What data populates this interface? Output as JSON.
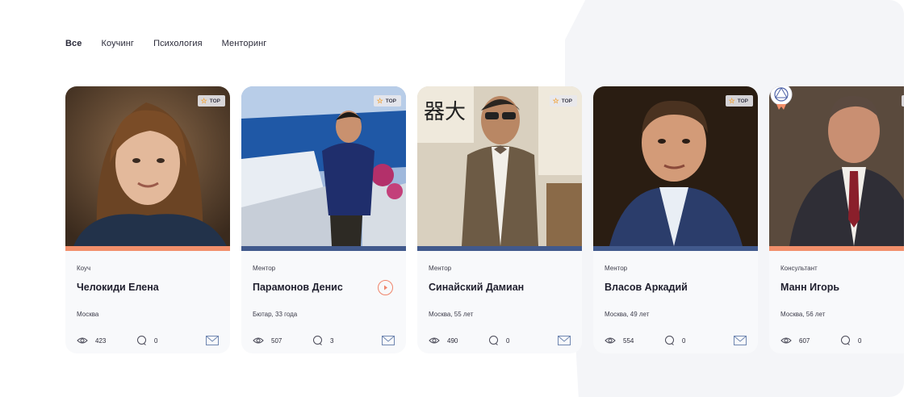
{
  "tabs": [
    {
      "label": "Все",
      "active": true
    },
    {
      "label": "Коучинг",
      "active": false
    },
    {
      "label": "Психология",
      "active": false
    },
    {
      "label": "Менторинг",
      "active": false
    }
  ],
  "badge_label": "TOP",
  "colors": {
    "accent_orange": "#f28f6b",
    "accent_blue": "#41598c",
    "card_bg": "#f8f9fb"
  },
  "cards": [
    {
      "role": "Коуч",
      "name": "Челокиди Елена",
      "location": "Москва",
      "views": "423",
      "comments": "0",
      "stripe": "orange",
      "top": true
    },
    {
      "role": "Ментор",
      "name": "Парамонов Денис",
      "location": "Бютар, 33 года",
      "views": "507",
      "comments": "3",
      "stripe": "blue",
      "top": true,
      "has_video": true
    },
    {
      "role": "Ментор",
      "name": "Синайский Дамиан",
      "location": "Москва, 55 лет",
      "views": "490",
      "comments": "0",
      "stripe": "blue",
      "top": true
    },
    {
      "role": "Ментор",
      "name": "Власов Аркадий",
      "location": "Москва, 49 лет",
      "views": "554",
      "comments": "0",
      "stripe": "blue",
      "top": true
    },
    {
      "role": "Консультант",
      "name": "Манн Игорь",
      "location": "Москва, 56 лет",
      "views": "607",
      "comments": "0",
      "stripe": "orange",
      "top": true,
      "award": true
    }
  ]
}
